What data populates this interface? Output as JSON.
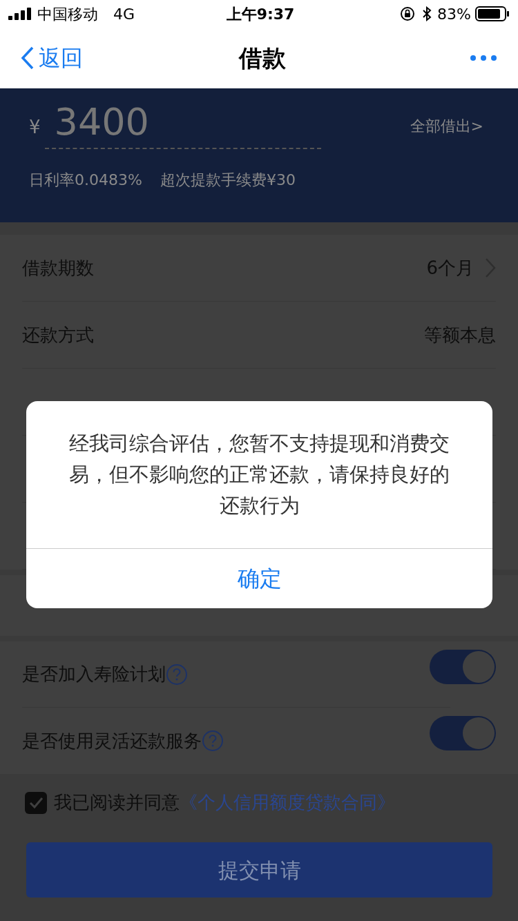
{
  "status_bar": {
    "carrier": "中国移动",
    "network": "4G",
    "time": "上午9:37",
    "battery": "83%"
  },
  "nav": {
    "back": "返回",
    "title": "借款"
  },
  "amount": {
    "currency": "¥",
    "value": "3400",
    "all_link": "全部借出>",
    "rate": "日利率0.0483%",
    "fee": "超次提款手续费¥30"
  },
  "rows": [
    {
      "label": "借款期数",
      "value": "6个月",
      "chevron": true
    },
    {
      "label": "还款方式",
      "value": "等额本息",
      "chevron": false
    }
  ],
  "toggles": [
    {
      "label": "是否加入寿险计划",
      "on": true
    },
    {
      "label": "是否使用灵活还款服务",
      "on": true
    }
  ],
  "agreement": {
    "checked": true,
    "text": "我已阅读并同意",
    "link": "《个人信用额度贷款合同》"
  },
  "submit": "提交申请",
  "dialog": {
    "message": "经我司综合评估，您暂不支持提现和消费交易，但不影响您的正常还款，请保持良好的还款行为",
    "button": "确定"
  }
}
